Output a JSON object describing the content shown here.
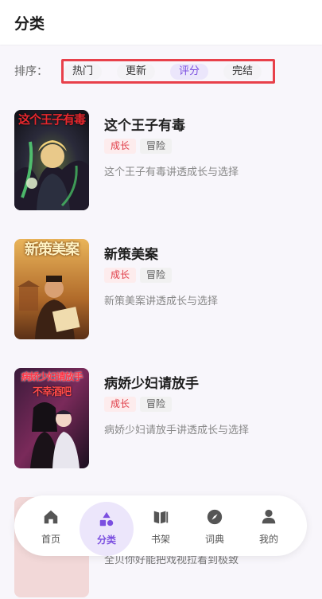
{
  "header": {
    "title": "分类"
  },
  "sort": {
    "label": "排序：",
    "options": [
      "热门",
      "更新",
      "评分",
      "完结"
    ],
    "active_index": 2
  },
  "books": [
    {
      "title": "这个王子有毒",
      "cover_text": "这个王子有毒",
      "tags": [
        "成长",
        "冒险"
      ],
      "desc": "这个王子有毒讲透成长与选择"
    },
    {
      "title": "新策美案",
      "cover_text": "新策美案",
      "tags": [
        "成长",
        "冒险"
      ],
      "desc": "新策美案讲透成长与选择"
    },
    {
      "title": "病娇少妇请放手",
      "cover_text": "病娇少妇请放手",
      "cover_subtext": "不幸酒吧",
      "tags": [
        "成长",
        "冒险"
      ],
      "desc": "病娇少妇请放手讲透成长与选择"
    }
  ],
  "partial_item": {
    "desc": "全贝你好能把戏视拉着到极致"
  },
  "nav": {
    "items": [
      {
        "label": "首页",
        "icon": "home-icon"
      },
      {
        "label": "分类",
        "icon": "category-icon"
      },
      {
        "label": "书架",
        "icon": "bookshelf-icon"
      },
      {
        "label": "词典",
        "icon": "compass-icon"
      },
      {
        "label": "我的",
        "icon": "user-icon"
      }
    ],
    "active_index": 1
  },
  "colors": {
    "accent": "#7b4fe0",
    "tag_red": "#e0404b",
    "highlight_box": "#e8404a"
  }
}
